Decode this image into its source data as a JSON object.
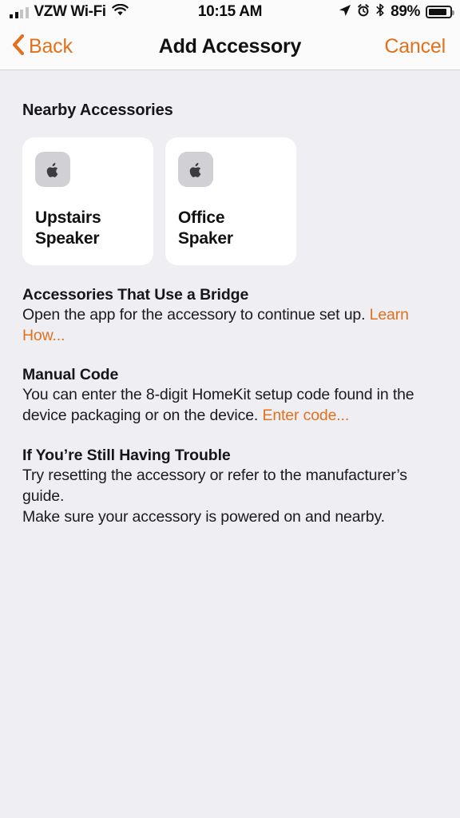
{
  "status_bar": {
    "carrier": "VZW Wi-Fi",
    "time": "10:15 AM",
    "battery_percent": "89%",
    "signal_bars_filled": 2,
    "signal_bars_total": 4,
    "icons": [
      "signal-bars-icon",
      "wifi-icon",
      "location-arrow-icon",
      "alarm-clock-icon",
      "bluetooth-icon",
      "battery-icon"
    ]
  },
  "nav_bar": {
    "back_label": "Back",
    "title": "Add Accessory",
    "cancel_label": "Cancel"
  },
  "main": {
    "section_label": "Nearby Accessories",
    "accessories": [
      {
        "name": "Upstairs Speaker",
        "icon": "apple-logo-icon"
      },
      {
        "name": "Office Spaker",
        "icon": "apple-logo-icon"
      }
    ],
    "info_blocks": [
      {
        "heading": "Accessories That Use a Bridge",
        "body": "Open the app for the accessory to continue set up.",
        "link": "Learn How..."
      },
      {
        "heading": "Manual Code",
        "body": "You can enter the 8-digit HomeKit setup code found in the device packaging or on the device.",
        "link": "Enter code..."
      },
      {
        "heading": "If You’re Still Having Trouble",
        "body_line1": "Try resetting the accessory or refer to the manufacturer’s guide.",
        "body_line2": "Make sure your accessory is powered on and nearby."
      }
    ]
  },
  "colors": {
    "accent": "#e2711d",
    "background": "#eeeef3",
    "bar_background": "#fbfbfb",
    "card_background": "#ffffff",
    "text_primary": "#111111",
    "icon_tile": "#d0d0d5"
  }
}
